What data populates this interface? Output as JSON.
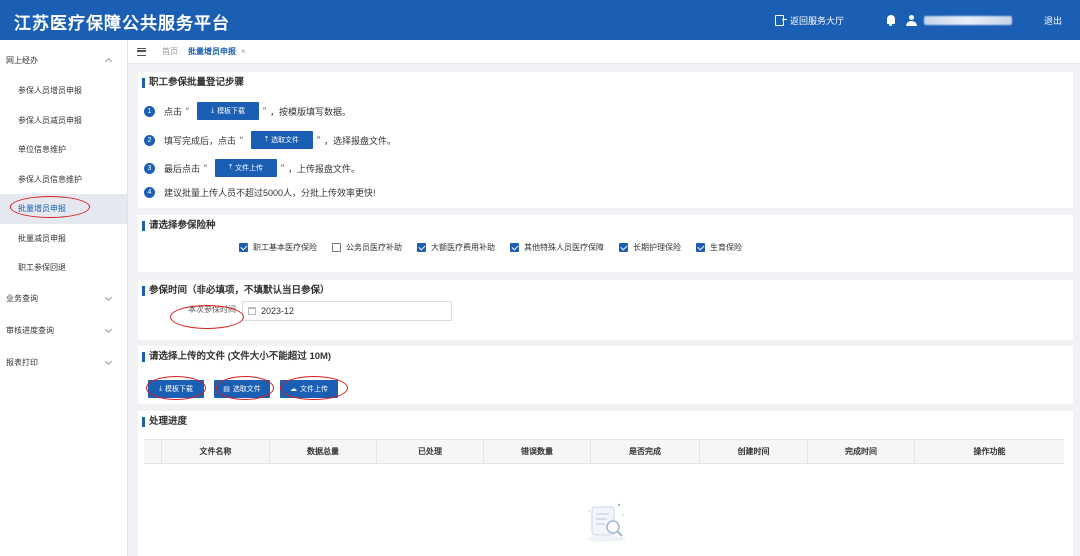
{
  "header": {
    "title": "江苏医疗保障公共服务平台",
    "back_label": "返回服务大厅",
    "logout_label": "退出"
  },
  "sidebar": {
    "group_main": "网上经办",
    "items": [
      "参保人员增员申报",
      "参保人员减员申报",
      "单位信息维护",
      "参保人员信息维护",
      "批量增员申报",
      "批量减员申报",
      "职工参保回退"
    ],
    "active_index": 4,
    "groups": [
      "业务查询",
      "审核进度查询",
      "报表打印"
    ]
  },
  "tabs": {
    "home": "首页",
    "active": "批量增员申报",
    "close": "×"
  },
  "steps": {
    "title": "职工参保批量登记步骤",
    "step1": {
      "num": "1",
      "prefix": "点击",
      "q_open": "“",
      "button": "模板下载",
      "q_close": "”",
      "suffix": "，按模版填写数据。"
    },
    "step2": {
      "num": "2",
      "prefix": "填写完成后，点击",
      "q_open": "“",
      "button": "选取文件",
      "q_close": "”",
      "suffix": "，选择报盘文件。"
    },
    "step3": {
      "num": "3",
      "prefix": "最后点击",
      "q_open": "“",
      "button": "文件上传",
      "q_close": "”",
      "suffix": "，上传报盘文件。"
    },
    "step4": {
      "num": "4",
      "text": "建议批量上传人员不超过5000人，分批上传效率更快!"
    }
  },
  "insurance": {
    "title": "请选择参保险种",
    "options": [
      {
        "label": "职工基本医疗保险",
        "checked": true
      },
      {
        "label": "公务员医疗补助",
        "checked": false
      },
      {
        "label": "大额医疗费用补助",
        "checked": true
      },
      {
        "label": "其他特殊人员医疗保障",
        "checked": true
      },
      {
        "label": "长期护理保险",
        "checked": true
      },
      {
        "label": "生育保险",
        "checked": true
      }
    ]
  },
  "period": {
    "title": "参保时间（非必填项，不填默认当日参保）",
    "label": "本次参保时间",
    "value": "2023-12"
  },
  "upload": {
    "title": "请选择上传的文件 (文件大小不能超过 10M)",
    "download_label": "模板下载",
    "select_label": "选取文件",
    "upload_label": "文件上传"
  },
  "progress": {
    "title": "处理进度",
    "columns": [
      "文件名称",
      "数据总量",
      "已处理",
      "错误数量",
      "是否完成",
      "创建时间",
      "完成时间",
      "操作功能"
    ]
  },
  "colors": {
    "primary": "#1a5fb4",
    "highlight": "#d81e1e"
  }
}
